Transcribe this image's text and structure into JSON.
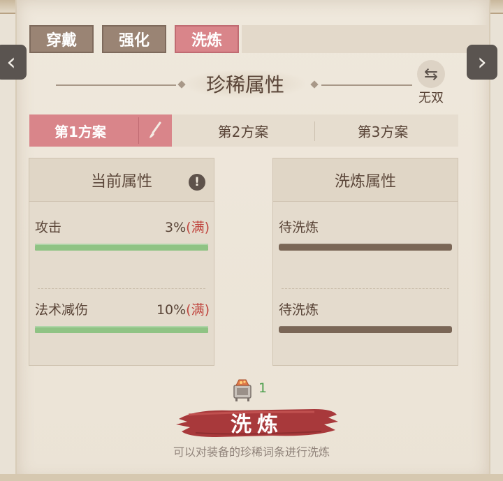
{
  "tabs": [
    {
      "label": "穿戴"
    },
    {
      "label": "强化"
    },
    {
      "label": "洗炼"
    }
  ],
  "active_tab": 2,
  "section": {
    "title": "珍稀属性",
    "switch_label": "无双"
  },
  "plans": [
    {
      "label": "第1方案"
    },
    {
      "label": "第2方案"
    },
    {
      "label": "第3方案"
    }
  ],
  "current": {
    "title": "当前属性",
    "attrs": [
      {
        "name": "攻击",
        "value": "3%",
        "suffix": "(满)",
        "fill": 1.0
      },
      {
        "name": "法术减伤",
        "value": "10%",
        "suffix": "(满)",
        "fill": 1.0
      }
    ]
  },
  "refined": {
    "title": "洗炼属性",
    "attrs": [
      {
        "name": "待洗炼"
      },
      {
        "name": "待洗炼"
      }
    ]
  },
  "material": {
    "count": "1"
  },
  "refine": {
    "label": "洗炼",
    "hint": "可以对装备的珍稀词条进行洗炼"
  },
  "colors": {
    "active_tab": "#d9858a",
    "full_text": "#c0463f",
    "bar_fill": "#8fc384",
    "count": "#4e9f4e"
  }
}
